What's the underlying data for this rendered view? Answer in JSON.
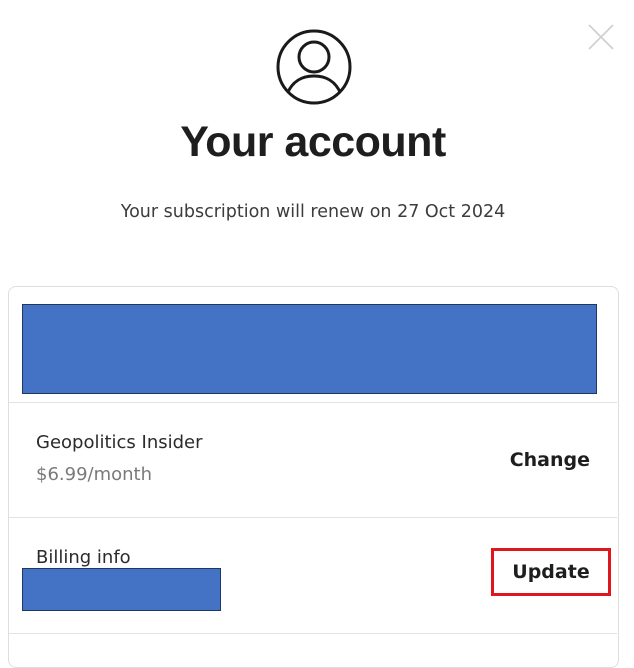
{
  "header": {
    "title": "Your account",
    "renewal_text": "Your subscription will renew on 27 Oct 2024"
  },
  "icons": {
    "avatar": "user-circle-icon",
    "close": "close-icon"
  },
  "plan": {
    "name": "Geopolitics Insider",
    "price": "$6.99/month",
    "action_label": "Change"
  },
  "billing": {
    "label": "Billing info",
    "action_label": "Update"
  },
  "colors": {
    "redaction": "#4472c4",
    "highlight": "#e0161e"
  }
}
